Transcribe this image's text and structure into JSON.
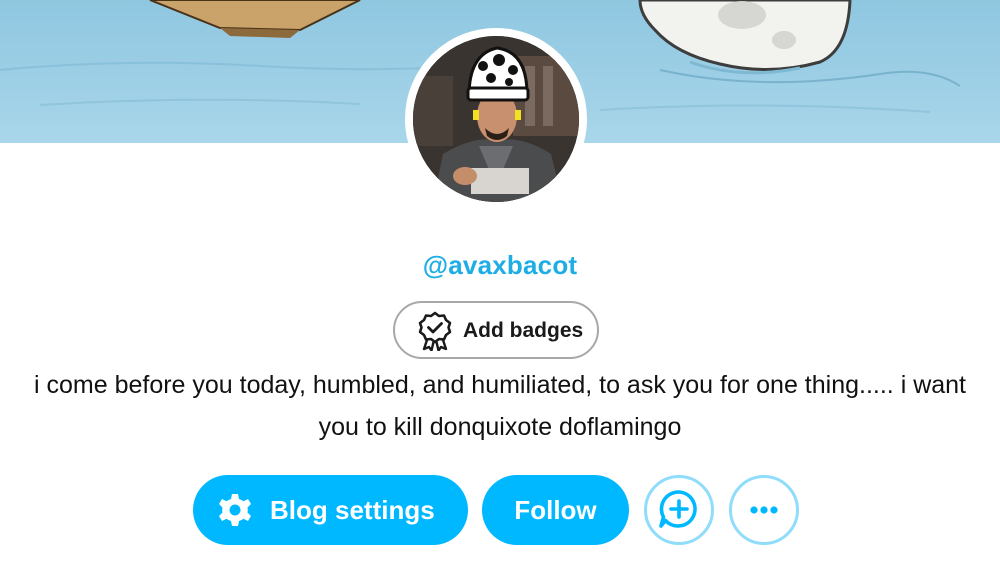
{
  "profile": {
    "username": "@avaxbacot",
    "description": "i come before you today, humbled, and humiliated, to ask you for one thing..... i want you to kill donquixote doflamingo"
  },
  "badges": {
    "add_label": "Add badges",
    "icon": "badge-ribbon-icon"
  },
  "actions": {
    "settings_label": "Blog settings",
    "settings_icon": "gear-icon",
    "follow_label": "Follow",
    "ask_icon": "chat-plus-icon",
    "more_icon": "ellipsis-icon"
  },
  "colors": {
    "accent": "#00b8ff",
    "username": "#1eaee5",
    "ring": "#8fdcfb"
  }
}
